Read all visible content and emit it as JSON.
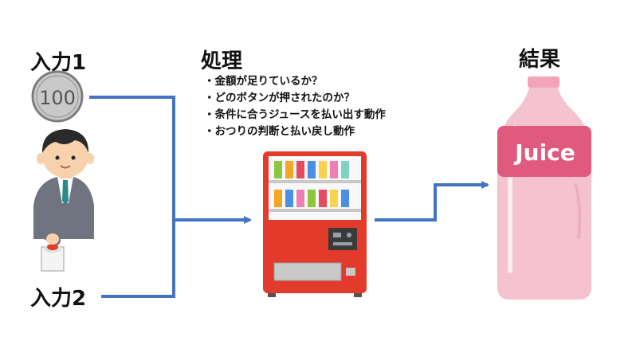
{
  "input1": {
    "label": "入力1"
  },
  "input2": {
    "label": "入力2"
  },
  "coin": {
    "value_text": "100"
  },
  "process": {
    "title": "処理",
    "items": [
      "・金額が足りているか？",
      "・どのボタンが押されたのか？",
      "・条件に合うジュースを払い出す動作",
      "・おつりの判断と払い戻し動作"
    ]
  },
  "result": {
    "title": "結果"
  },
  "bottle": {
    "label": "Juice"
  },
  "colors": {
    "arrow": "#4472c4",
    "machine_red": "#e23b2c",
    "bottle_pink": "#f4c3cf",
    "label_pink": "#e05a7e"
  }
}
